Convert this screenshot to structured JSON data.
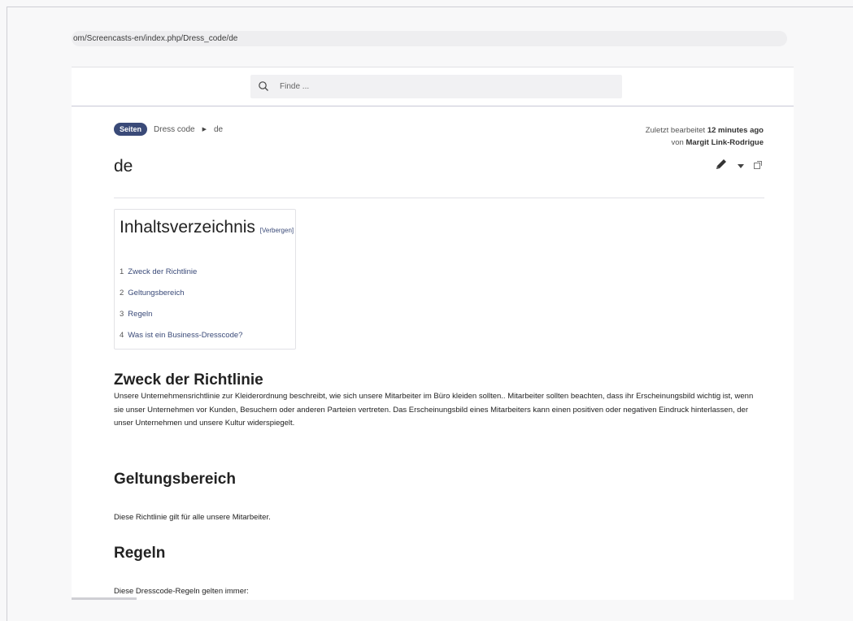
{
  "browser": {
    "url": "om/Screencasts-en/index.php/Dress_code/de"
  },
  "search": {
    "placeholder": "Finde ..."
  },
  "breadcrumb": {
    "badge": "Seiten",
    "items": [
      "Dress code",
      "de"
    ]
  },
  "edited": {
    "prefix": "Zuletzt bearbeitet",
    "time": "12 minutes ago",
    "by_prefix": "von",
    "author": "Margit Link-Rodrigue"
  },
  "page": {
    "title": "de"
  },
  "icons": {
    "edit": "pencil-icon",
    "more": "caret-down-icon",
    "popout": "external-window-icon",
    "search": "search-icon"
  },
  "toc": {
    "title": "Inhaltsverzeichnis",
    "toggle": "[Verbergen]",
    "items": [
      {
        "num": "1",
        "label": "Zweck der Richtlinie"
      },
      {
        "num": "2",
        "label": "Geltungsbereich"
      },
      {
        "num": "3",
        "label": "Regeln"
      },
      {
        "num": "4",
        "label": "Was ist ein Business-Dresscode?"
      }
    ]
  },
  "sections": [
    {
      "heading": "Zweck der Richtlinie",
      "text": "Unsere Unternehmensrichtlinie zur Kleiderordnung beschreibt, wie sich unsere Mitarbeiter im Büro kleiden sollten.. Mitarbeiter sollten beachten, dass ihr Erscheinungsbild wichtig ist, wenn sie unser Unternehmen vor Kunden, Besuchern oder anderen Parteien vertreten. Das Erscheinungsbild eines Mitarbeiters kann einen positiven oder negativen Eindruck hinterlassen, der unser Unternehmen und unsere Kultur widerspiegelt."
    },
    {
      "heading": "Geltungsbereich",
      "text": "Diese Richtlinie gilt für alle unsere Mitarbeiter."
    },
    {
      "heading": "Regeln",
      "text": "Diese Dresscode-Regeln gelten immer:"
    }
  ]
}
